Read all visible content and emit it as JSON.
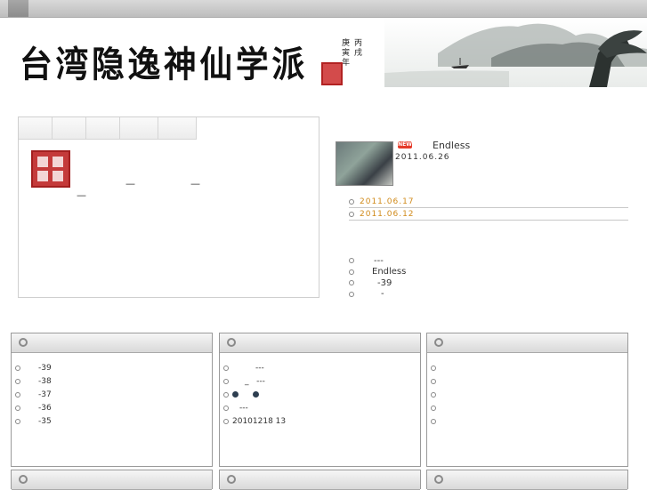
{
  "banner": {
    "title": "台湾隐逸神仙学派",
    "poem_col1": "庚寅年",
    "poem_col2": "丙戌"
  },
  "news": {
    "new_badge": "NEW",
    "headline": "Endless",
    "headline_date": "2011.06.26",
    "dated_items": [
      "2011.06.17",
      "2011.06.12"
    ],
    "links": [
      "---",
      "Endless",
      "-39",
      "-"
    ]
  },
  "boxes": [
    {
      "rows": [
        "-39",
        "-38",
        "-37",
        "-36",
        "-35"
      ]
    },
    {
      "rows": [
        "---",
        "_   ---",
        "",
        "---",
        "20101218 13"
      ]
    },
    {
      "rows": [
        "",
        "",
        "",
        "",
        ""
      ]
    }
  ],
  "colors": {
    "date_accent": "#d08a1a",
    "badge_red": "#e53b2a",
    "seal_red": "#c43a3a"
  }
}
